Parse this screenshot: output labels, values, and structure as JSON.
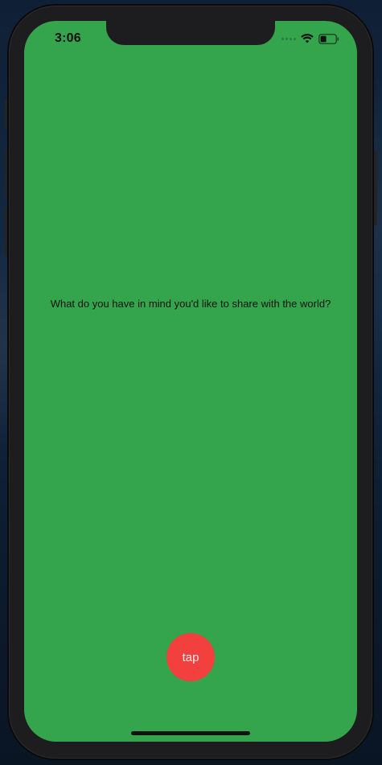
{
  "status_bar": {
    "time": "3:06",
    "icons": [
      "cellular-signal-icon",
      "wifi-icon",
      "battery-icon"
    ]
  },
  "main": {
    "prompt": "What do you have in mind you'd like to share with the world?",
    "tap_button_label": "tap"
  },
  "colors": {
    "screen_background": "#34a54c",
    "button_background": "#f2403f",
    "text": "#111111"
  }
}
